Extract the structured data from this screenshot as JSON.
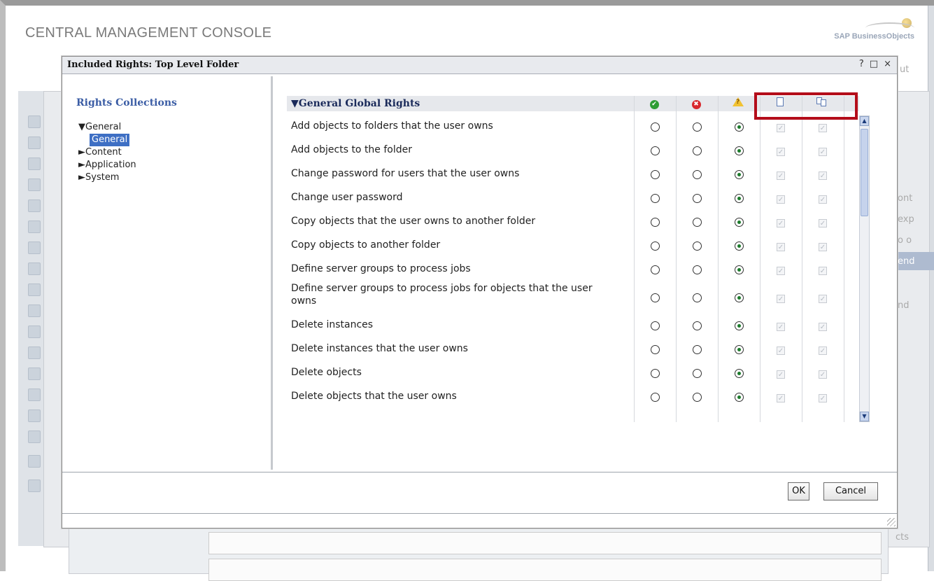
{
  "console": {
    "title": "CENTRAL MANAGEMENT CONSOLE",
    "brand": "SAP BusinessObjects",
    "bg_snippets": [
      "ut",
      "ont",
      "exp",
      "o o",
      "end",
      "nd",
      "cts"
    ]
  },
  "dialog": {
    "title": "Included Rights: Top Level Folder",
    "help": "?",
    "maximize": "□",
    "close": "×",
    "ok_label": "OK",
    "cancel_label": "Cancel"
  },
  "sidebar": {
    "heading": "Rights Collections",
    "items": [
      {
        "label": "▼General"
      },
      {
        "label": "General"
      },
      {
        "label": "►Content"
      },
      {
        "label": "►Application"
      },
      {
        "label": "►System"
      }
    ]
  },
  "grid": {
    "section_title": "▼General Global Rights",
    "columns": [
      "granted-icon",
      "denied-icon",
      "not-specified-icon",
      "apply-to-object-icon",
      "apply-to-subobjects-icon"
    ],
    "rows": [
      {
        "label": "Add objects to folders that the user owns",
        "state": "not-specified"
      },
      {
        "label": "Add objects to the folder",
        "state": "not-specified"
      },
      {
        "label": "Change password for users that the user owns",
        "state": "not-specified"
      },
      {
        "label": "Change user password",
        "state": "not-specified"
      },
      {
        "label": "Copy objects that the user owns to another folder",
        "state": "not-specified"
      },
      {
        "label": "Copy objects to another folder",
        "state": "not-specified"
      },
      {
        "label": "Define server groups to process jobs",
        "state": "not-specified"
      },
      {
        "label": "Define server groups to process jobs for objects that the user owns",
        "state": "not-specified"
      },
      {
        "label": "Delete instances",
        "state": "not-specified"
      },
      {
        "label": "Delete instances that the user owns",
        "state": "not-specified"
      },
      {
        "label": "Delete objects",
        "state": "not-specified"
      },
      {
        "label": "Delete objects that the user owns",
        "state": "not-specified"
      }
    ]
  },
  "colors": {
    "accent": "#3b5da5",
    "highlight_box": "#b40d1a",
    "selected_tree": "#3e6fc4"
  }
}
